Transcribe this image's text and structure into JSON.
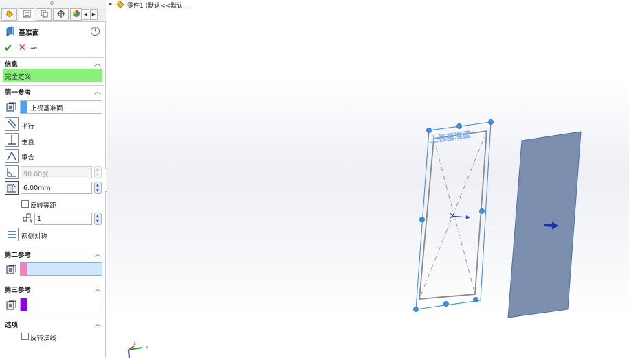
{
  "feature": {
    "title": "基准面",
    "help": "?"
  },
  "tabs": [
    "feature-manager",
    "property-manager",
    "configuration-manager",
    "dimxpert-manager",
    "display-manager"
  ],
  "actions": {
    "ok": "✔",
    "cancel": "✕",
    "pin": "⊸"
  },
  "info": {
    "title": "信息",
    "status": "完全定义"
  },
  "first_ref": {
    "title": "第一参考",
    "value": "上视基准面",
    "swatch_color": "#4aa3f0",
    "constraints": {
      "parallel": "平行",
      "perpendicular": "垂直",
      "coincident": "重合"
    },
    "angle_value": "90.00度",
    "distance_value": "6.00mm",
    "flip_offset_label": "反转等距",
    "count_value": "1",
    "mid_plane_label": "两侧对称"
  },
  "second_ref": {
    "title": "第二参考",
    "value": "",
    "swatch_color": "#f77fc0",
    "field_bg": "#cfe6fb"
  },
  "third_ref": {
    "title": "第三参考",
    "value": "",
    "swatch_color": "#8b00e8"
  },
  "options": {
    "title": "选项",
    "flip_normal_label": "反转法线"
  },
  "tree": {
    "text": "零件1 (默认<<默认..."
  },
  "viewport": {
    "plane_label": "上视基准面",
    "preview_plane_color": "#7d8fae",
    "selection_color": "#3b8fe8",
    "triad_x": "X",
    "triad_y": "Y"
  }
}
